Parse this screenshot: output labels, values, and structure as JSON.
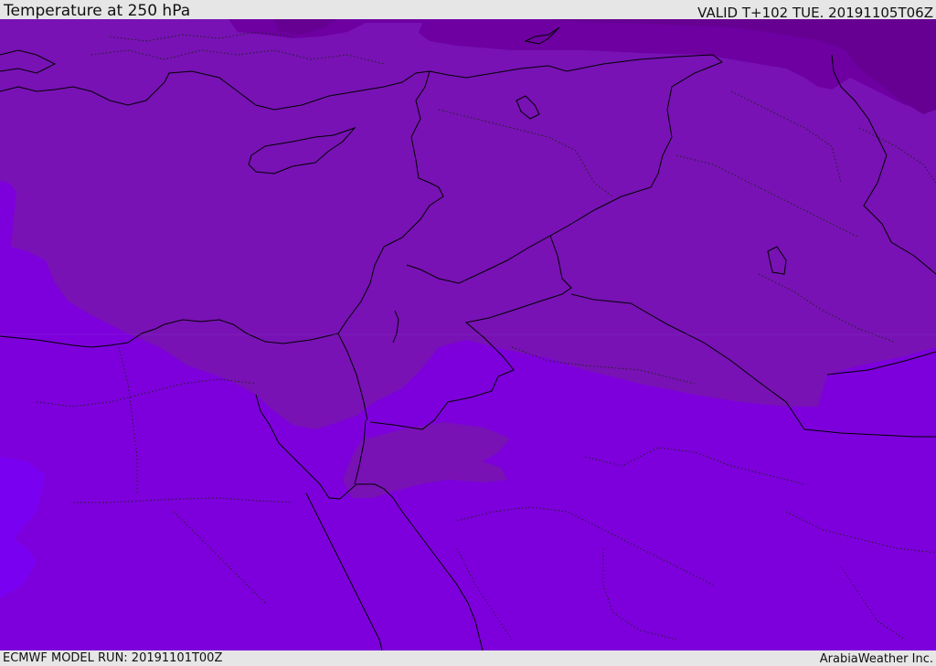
{
  "header": {
    "title": "Temperature at 250 hPa",
    "valid": "VALID T+102 TUE. 20191105T06Z"
  },
  "footer": {
    "model_run": "ECMWF MODEL RUN: 20191101T00Z",
    "credit": "ArabiaWeather Inc."
  },
  "colors": {
    "band_warmest": "#7a00f2",
    "band_warm": "#7d00dc",
    "band_mid": "#7812b4",
    "band_cool": "#6e00a2",
    "band_coolest": "#650092",
    "coastline": "#000000",
    "border": "#222222"
  }
}
